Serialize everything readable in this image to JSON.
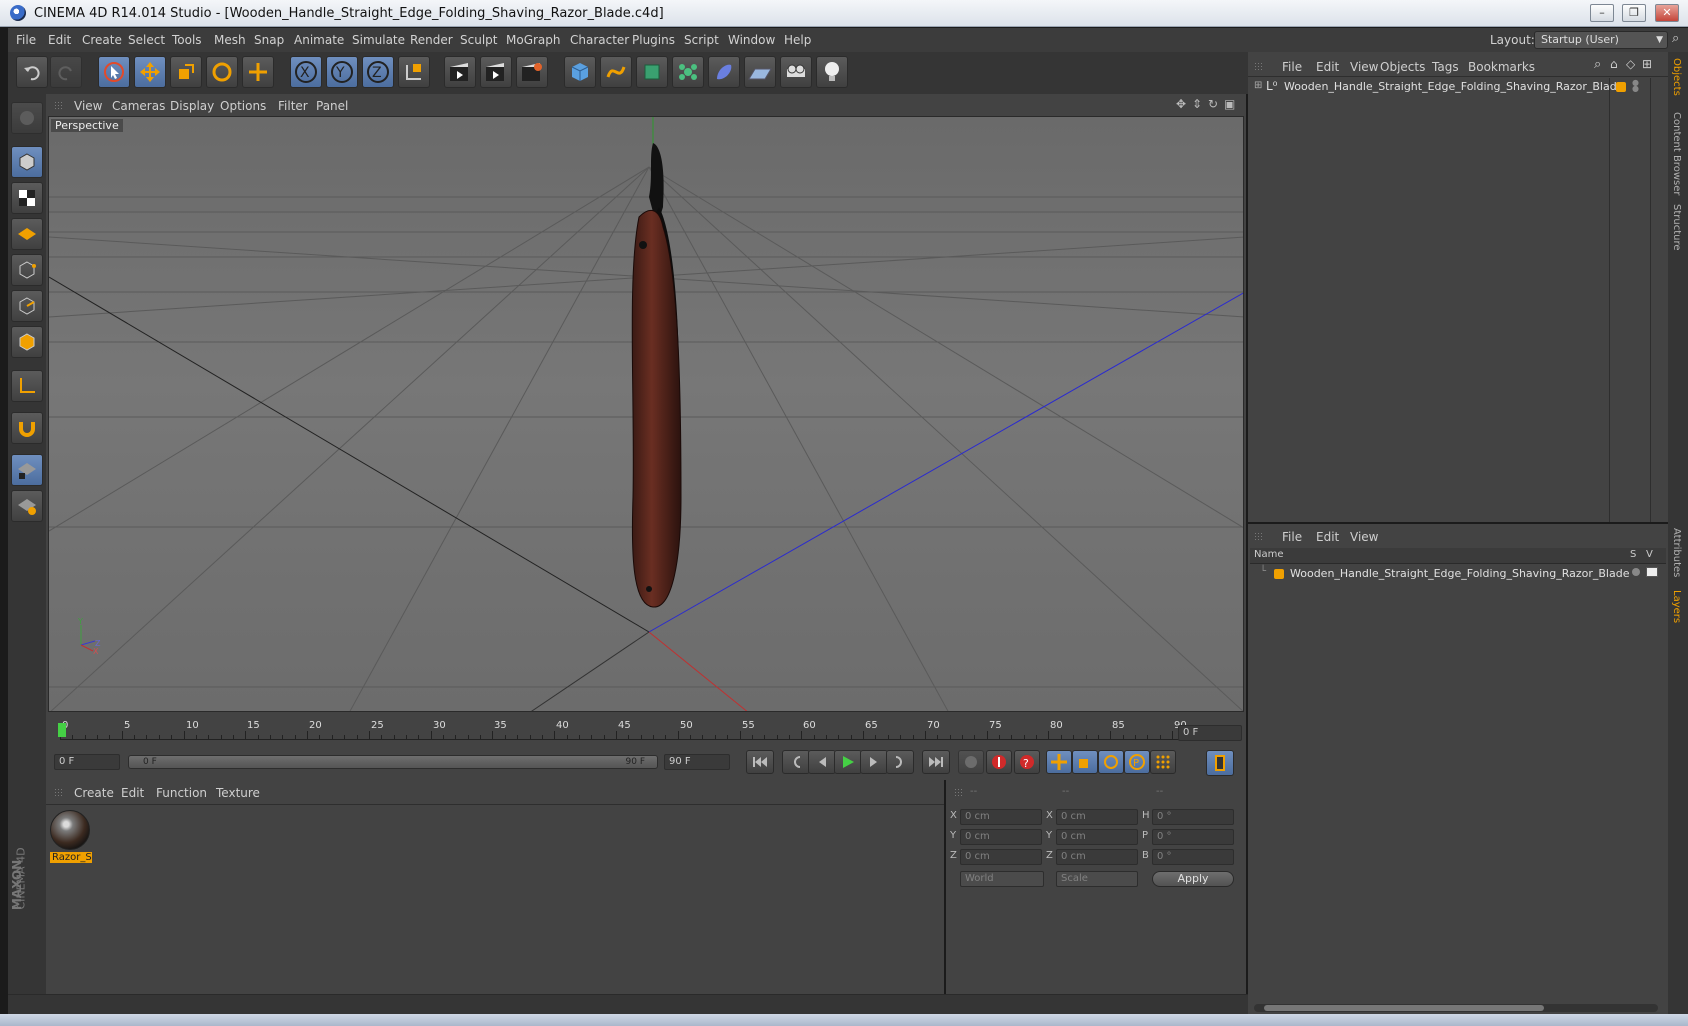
{
  "window": {
    "title": "CINEMA 4D R14.014 Studio - [Wooden_Handle_Straight_Edge_Folding_Shaving_Razor_Blade.c4d]"
  },
  "menubar": [
    "File",
    "Edit",
    "Create",
    "Select",
    "Tools",
    "Mesh",
    "Snap",
    "Animate",
    "Simulate",
    "Render",
    "Sculpt",
    "MoGraph",
    "Character",
    "Plugins",
    "Script",
    "Window",
    "Help"
  ],
  "layout": {
    "label": "Layout:",
    "value": "Startup (User)"
  },
  "viewport": {
    "menu": [
      "View",
      "Cameras",
      "Display",
      "Options",
      "Filter",
      "Panel"
    ],
    "label": "Perspective"
  },
  "object_manager": {
    "menu": [
      "File",
      "Edit",
      "View",
      "Objects",
      "Tags",
      "Bookmarks"
    ],
    "object_name": "Wooden_Handle_Straight_Edge_Folding_Shaving_Razor_Blade"
  },
  "layer_manager": {
    "menu": [
      "File",
      "Edit",
      "View"
    ],
    "columns": {
      "name": "Name",
      "s": "S",
      "v": "V"
    },
    "layer_name": "Wooden_Handle_Straight_Edge_Folding_Shaving_Razor_Blade"
  },
  "right_tabs": [
    "Objects",
    "Content Browser",
    "Structure"
  ],
  "right_tabs_lower": [
    "Attributes",
    "Layers"
  ],
  "timeline": {
    "ticks": [
      "0",
      "5",
      "10",
      "15",
      "20",
      "25",
      "30",
      "35",
      "40",
      "45",
      "50",
      "55",
      "60",
      "65",
      "70",
      "75",
      "80",
      "85",
      "90"
    ],
    "current_frame": "0 F",
    "start_field": "0 F",
    "range_start": "0 F",
    "range_end": "90 F",
    "end_field": "90 F"
  },
  "material_manager": {
    "menu": [
      "Create",
      "Edit",
      "Function",
      "Texture"
    ],
    "material_name": "Razor_S"
  },
  "coordinates": {
    "headers": [
      "--",
      "--",
      "--"
    ],
    "rows": [
      {
        "l1": "X",
        "v1": "0 cm",
        "l2": "X",
        "v2": "0 cm",
        "l3": "H",
        "v3": "0 °"
      },
      {
        "l1": "Y",
        "v1": "0 cm",
        "l2": "Y",
        "v2": "0 cm",
        "l3": "P",
        "v3": "0 °"
      },
      {
        "l1": "Z",
        "v1": "0 cm",
        "l2": "Z",
        "v2": "0 cm",
        "l3": "B",
        "v3": "0 °"
      }
    ],
    "mode": "World",
    "scale_mode": "Scale",
    "apply": "Apply"
  },
  "branding": {
    "maxon": "MAXON",
    "product": "CINEMA 4D"
  },
  "axis_labels": {
    "y": "Y",
    "z": "Z",
    "x": "X"
  },
  "colors": {
    "accent": "#f0a000",
    "selection_blue": "#5577aa",
    "bg": "#434343"
  }
}
